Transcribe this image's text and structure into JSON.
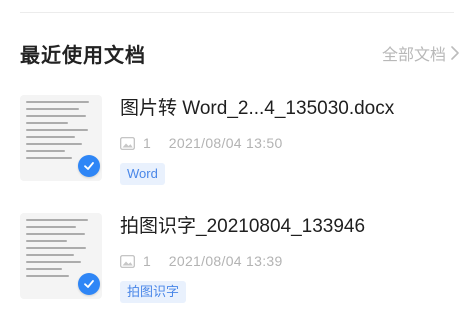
{
  "section": {
    "title": "最近使用文档",
    "see_all_label": "全部文档"
  },
  "files": [
    {
      "name": "图片转 Word_2...4_135030.docx",
      "page_count": "1",
      "date": "2021/08/04 13:50",
      "tag": "Word"
    },
    {
      "name": "拍图识字_20210804_133946",
      "page_count": "1",
      "date": "2021/08/04 13:39",
      "tag": "拍图识字"
    }
  ],
  "colors": {
    "accent": "#2f86f6",
    "tag_bg": "#e9f1fd",
    "tag_text": "#4a87e8",
    "muted": "#b3b3b3"
  },
  "icons": {
    "see_all": "chevron-right-icon",
    "pages": "image-icon",
    "selected": "check-badge-icon"
  }
}
